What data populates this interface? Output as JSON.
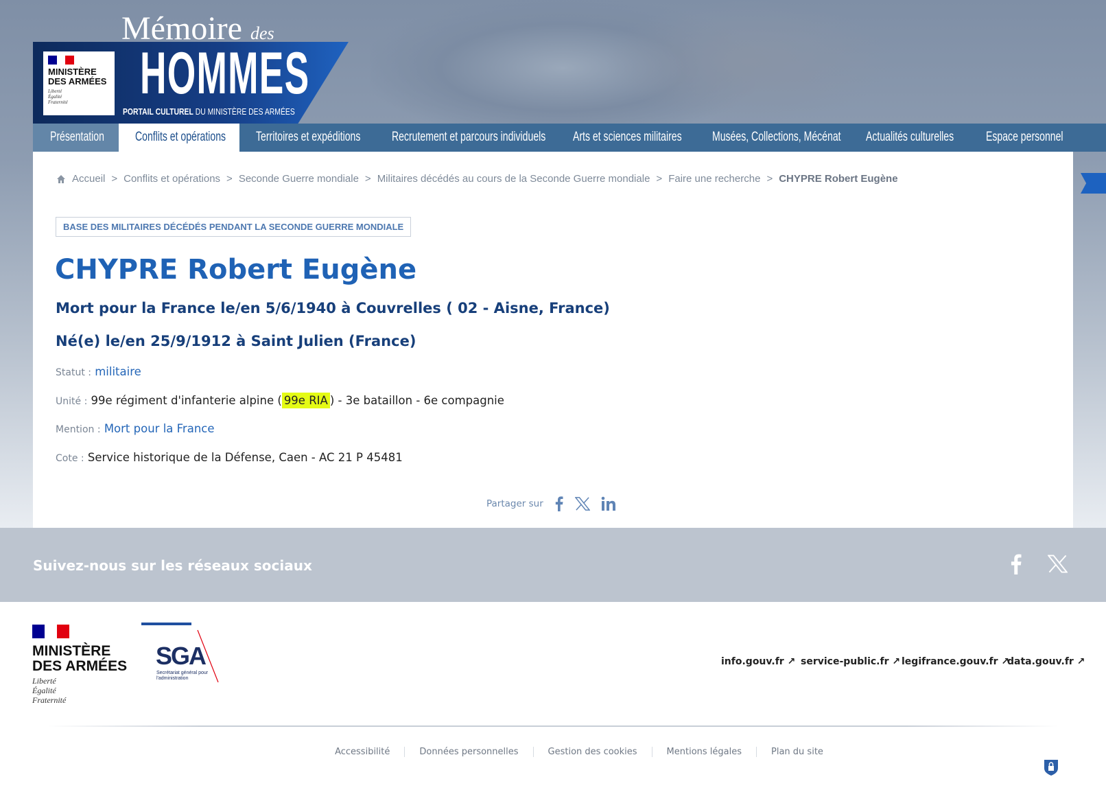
{
  "header": {
    "site_title_1": "Mémoire",
    "site_title_des": "des",
    "site_title_2": "HOMMES",
    "tagline_bold": "PORTAIL CULTUREL",
    "tagline_rest": " DU MINISTÈRE DES ARMÉES",
    "ministry": {
      "line1": "MINISTÈRE",
      "line2": "DES ARMÉES",
      "devise": [
        "Liberté",
        "Égalité",
        "Fraternité"
      ]
    }
  },
  "nav": {
    "items": [
      {
        "label": "Présentation"
      },
      {
        "label": "Conflits et opérations",
        "active": true
      },
      {
        "label": "Territoires et expéditions"
      },
      {
        "label": "Recrutement et parcours individuels"
      },
      {
        "label": "Arts et sciences militaires"
      },
      {
        "label": "Musées, Collections, Mécénat"
      },
      {
        "label": "Actualités culturelles"
      },
      {
        "label": "Espace personnel"
      }
    ]
  },
  "breadcrumb": [
    "Accueil",
    "Conflits et opérations",
    "Seconde Guerre mondiale",
    "Militaires décédés au cours de la Seconde Guerre mondiale",
    "Faire une recherche",
    "CHYPRE Robert Eugène"
  ],
  "record": {
    "database": "BASE DES MILITAIRES DÉCÉDÉS PENDANT LA SECONDE GUERRE MONDIALE",
    "name": "CHYPRE Robert Eugène",
    "death": "Mort pour la France le/en 5/6/1940 à Couvrelles ( 02 - Aisne, France)",
    "birth": "Né(e) le/en 25/9/1912 à Saint Julien (France)",
    "statut_label": "Statut :",
    "statut": "militaire",
    "unite_label": "Unité :",
    "unite_before": "99e régiment d'infanterie alpine (",
    "unite_highlight": "99e RIA",
    "unite_after": ") - 3e bataillon - 6e compagnie",
    "mention_label": "Mention :",
    "mention": "Mort pour la France",
    "cote_label": "Cote :",
    "cote": "Service historique de la Défense, Caen - AC 21 P 45481"
  },
  "share": {
    "label": "Partager sur",
    "icons": [
      "facebook-icon",
      "x-icon",
      "linkedin-icon"
    ]
  },
  "social": {
    "title": "Suivez-nous sur les réseaux sociaux",
    "icons": [
      "facebook-icon",
      "x-icon"
    ]
  },
  "footer": {
    "ministry": {
      "line1": "MINISTÈRE",
      "line2": "DES ARMÉES",
      "devise": [
        "Liberté",
        "Égalité",
        "Fraternité"
      ]
    },
    "sga": {
      "acronym": "SGA",
      "subtitle": "Secrétariat général pour l'administration"
    },
    "external_links": [
      "info.gouv.fr",
      "service-public.fr",
      "legifrance.gouv.fr",
      "data.gouv.fr"
    ],
    "bottom_links": [
      "Accessibilité",
      "Données personnelles",
      "Gestion des cookies",
      "Mentions légales",
      "Plan du site"
    ]
  },
  "colors": {
    "primary": "#1f62b5",
    "nav": "#3d6b96",
    "highlight": "#e4fb15",
    "social_bar": "#bcc4cf",
    "marianne_blue": "#000091",
    "marianne_red": "#e1000f"
  }
}
